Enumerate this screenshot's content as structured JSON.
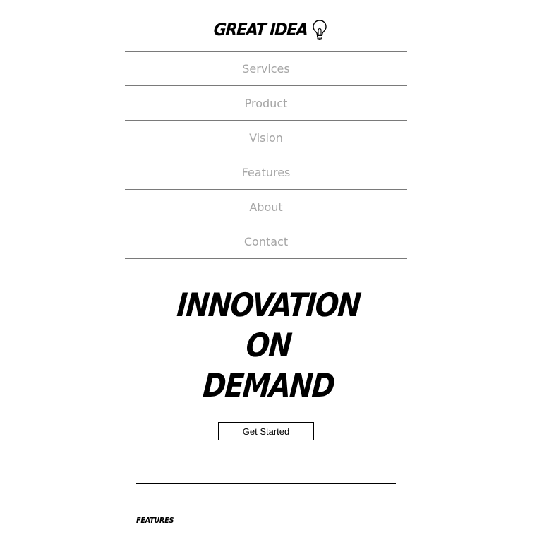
{
  "logo": {
    "text": "GREAT IDEA",
    "icon": "lightbulb-icon"
  },
  "nav": {
    "items": [
      {
        "label": "Services"
      },
      {
        "label": "Product"
      },
      {
        "label": "Vision"
      },
      {
        "label": "Features"
      },
      {
        "label": "About"
      },
      {
        "label": "Contact"
      }
    ]
  },
  "hero": {
    "lines": [
      "INNOVATION",
      "ON",
      "DEMAND"
    ]
  },
  "cta": {
    "label": "Get Started"
  },
  "section": {
    "label": "FEATURES"
  },
  "colors": {
    "background": "#ffffff",
    "text": "#000000",
    "nav_text": "#a6a6a6",
    "nav_border": "#7a7a7a"
  }
}
